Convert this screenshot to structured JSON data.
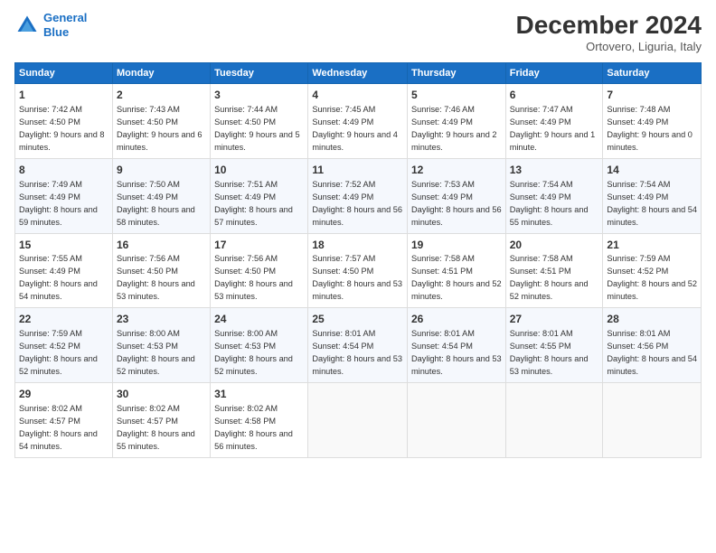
{
  "header": {
    "logo_line1": "General",
    "logo_line2": "Blue",
    "title": "December 2024",
    "subtitle": "Ortovero, Liguria, Italy"
  },
  "weekdays": [
    "Sunday",
    "Monday",
    "Tuesday",
    "Wednesday",
    "Thursday",
    "Friday",
    "Saturday"
  ],
  "weeks": [
    [
      {
        "day": "1",
        "info": "Sunrise: 7:42 AM\nSunset: 4:50 PM\nDaylight: 9 hours and 8 minutes."
      },
      {
        "day": "2",
        "info": "Sunrise: 7:43 AM\nSunset: 4:50 PM\nDaylight: 9 hours and 6 minutes."
      },
      {
        "day": "3",
        "info": "Sunrise: 7:44 AM\nSunset: 4:50 PM\nDaylight: 9 hours and 5 minutes."
      },
      {
        "day": "4",
        "info": "Sunrise: 7:45 AM\nSunset: 4:49 PM\nDaylight: 9 hours and 4 minutes."
      },
      {
        "day": "5",
        "info": "Sunrise: 7:46 AM\nSunset: 4:49 PM\nDaylight: 9 hours and 2 minutes."
      },
      {
        "day": "6",
        "info": "Sunrise: 7:47 AM\nSunset: 4:49 PM\nDaylight: 9 hours and 1 minute."
      },
      {
        "day": "7",
        "info": "Sunrise: 7:48 AM\nSunset: 4:49 PM\nDaylight: 9 hours and 0 minutes."
      }
    ],
    [
      {
        "day": "8",
        "info": "Sunrise: 7:49 AM\nSunset: 4:49 PM\nDaylight: 8 hours and 59 minutes."
      },
      {
        "day": "9",
        "info": "Sunrise: 7:50 AM\nSunset: 4:49 PM\nDaylight: 8 hours and 58 minutes."
      },
      {
        "day": "10",
        "info": "Sunrise: 7:51 AM\nSunset: 4:49 PM\nDaylight: 8 hours and 57 minutes."
      },
      {
        "day": "11",
        "info": "Sunrise: 7:52 AM\nSunset: 4:49 PM\nDaylight: 8 hours and 56 minutes."
      },
      {
        "day": "12",
        "info": "Sunrise: 7:53 AM\nSunset: 4:49 PM\nDaylight: 8 hours and 56 minutes."
      },
      {
        "day": "13",
        "info": "Sunrise: 7:54 AM\nSunset: 4:49 PM\nDaylight: 8 hours and 55 minutes."
      },
      {
        "day": "14",
        "info": "Sunrise: 7:54 AM\nSunset: 4:49 PM\nDaylight: 8 hours and 54 minutes."
      }
    ],
    [
      {
        "day": "15",
        "info": "Sunrise: 7:55 AM\nSunset: 4:49 PM\nDaylight: 8 hours and 54 minutes."
      },
      {
        "day": "16",
        "info": "Sunrise: 7:56 AM\nSunset: 4:50 PM\nDaylight: 8 hours and 53 minutes."
      },
      {
        "day": "17",
        "info": "Sunrise: 7:56 AM\nSunset: 4:50 PM\nDaylight: 8 hours and 53 minutes."
      },
      {
        "day": "18",
        "info": "Sunrise: 7:57 AM\nSunset: 4:50 PM\nDaylight: 8 hours and 53 minutes."
      },
      {
        "day": "19",
        "info": "Sunrise: 7:58 AM\nSunset: 4:51 PM\nDaylight: 8 hours and 52 minutes."
      },
      {
        "day": "20",
        "info": "Sunrise: 7:58 AM\nSunset: 4:51 PM\nDaylight: 8 hours and 52 minutes."
      },
      {
        "day": "21",
        "info": "Sunrise: 7:59 AM\nSunset: 4:52 PM\nDaylight: 8 hours and 52 minutes."
      }
    ],
    [
      {
        "day": "22",
        "info": "Sunrise: 7:59 AM\nSunset: 4:52 PM\nDaylight: 8 hours and 52 minutes."
      },
      {
        "day": "23",
        "info": "Sunrise: 8:00 AM\nSunset: 4:53 PM\nDaylight: 8 hours and 52 minutes."
      },
      {
        "day": "24",
        "info": "Sunrise: 8:00 AM\nSunset: 4:53 PM\nDaylight: 8 hours and 52 minutes."
      },
      {
        "day": "25",
        "info": "Sunrise: 8:01 AM\nSunset: 4:54 PM\nDaylight: 8 hours and 53 minutes."
      },
      {
        "day": "26",
        "info": "Sunrise: 8:01 AM\nSunset: 4:54 PM\nDaylight: 8 hours and 53 minutes."
      },
      {
        "day": "27",
        "info": "Sunrise: 8:01 AM\nSunset: 4:55 PM\nDaylight: 8 hours and 53 minutes."
      },
      {
        "day": "28",
        "info": "Sunrise: 8:01 AM\nSunset: 4:56 PM\nDaylight: 8 hours and 54 minutes."
      }
    ],
    [
      {
        "day": "29",
        "info": "Sunrise: 8:02 AM\nSunset: 4:57 PM\nDaylight: 8 hours and 54 minutes."
      },
      {
        "day": "30",
        "info": "Sunrise: 8:02 AM\nSunset: 4:57 PM\nDaylight: 8 hours and 55 minutes."
      },
      {
        "day": "31",
        "info": "Sunrise: 8:02 AM\nSunset: 4:58 PM\nDaylight: 8 hours and 56 minutes."
      },
      null,
      null,
      null,
      null
    ]
  ]
}
